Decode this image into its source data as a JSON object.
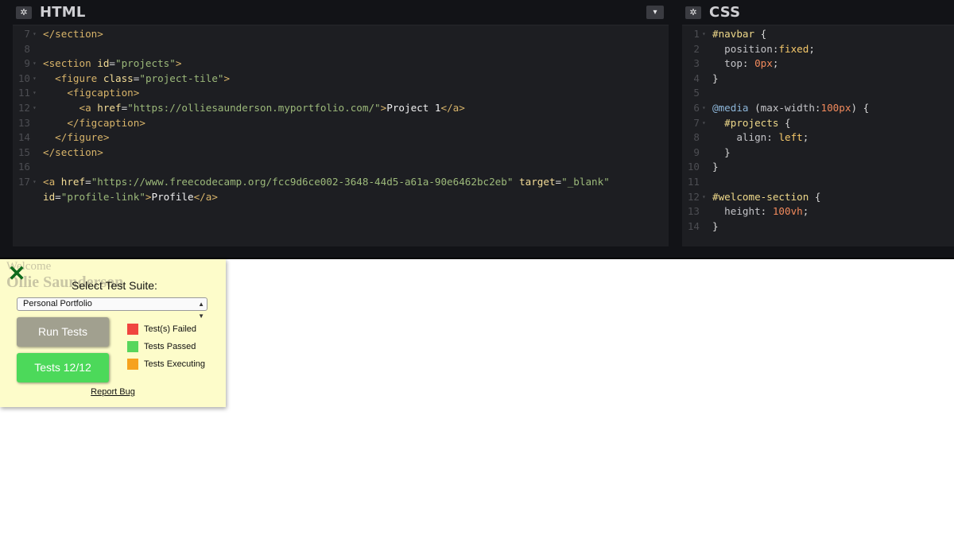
{
  "editors": {
    "html": {
      "title": "HTML",
      "lines": [
        {
          "n": "7",
          "fold": "▾",
          "parts": [
            {
              "c": "t-tag",
              "t": "</section>"
            }
          ]
        },
        {
          "n": "8",
          "fold": "",
          "parts": []
        },
        {
          "n": "9",
          "fold": "▾",
          "parts": [
            {
              "c": "t-tag",
              "t": "<section "
            },
            {
              "c": "t-attr",
              "t": "id"
            },
            {
              "c": "t-pun",
              "t": "="
            },
            {
              "c": "t-str",
              "t": "\"projects\""
            },
            {
              "c": "t-tag",
              "t": ">"
            }
          ]
        },
        {
          "n": "10",
          "fold": "▾",
          "parts": [
            {
              "c": "t-pun",
              "t": "  "
            },
            {
              "c": "t-tag",
              "t": "<figure "
            },
            {
              "c": "t-attr",
              "t": "class"
            },
            {
              "c": "t-pun",
              "t": "="
            },
            {
              "c": "t-str",
              "t": "\"project-tile\""
            },
            {
              "c": "t-tag",
              "t": ">"
            }
          ]
        },
        {
          "n": "11",
          "fold": "▾",
          "parts": [
            {
              "c": "t-pun",
              "t": "    "
            },
            {
              "c": "t-tag",
              "t": "<figcaption>"
            }
          ]
        },
        {
          "n": "12",
          "fold": "▾",
          "parts": [
            {
              "c": "t-pun",
              "t": "      "
            },
            {
              "c": "t-tag",
              "t": "<a "
            },
            {
              "c": "t-attr",
              "t": "href"
            },
            {
              "c": "t-pun",
              "t": "="
            },
            {
              "c": "t-str",
              "t": "\"https://olliesaunderson.myportfolio.com/\""
            },
            {
              "c": "t-tag",
              "t": ">"
            },
            {
              "c": "t-txt",
              "t": "Project 1"
            },
            {
              "c": "t-tag",
              "t": "</a>"
            }
          ]
        },
        {
          "n": "13",
          "fold": "",
          "parts": [
            {
              "c": "t-pun",
              "t": "    "
            },
            {
              "c": "t-tag",
              "t": "</figcaption>"
            }
          ]
        },
        {
          "n": "14",
          "fold": "",
          "parts": [
            {
              "c": "t-pun",
              "t": "  "
            },
            {
              "c": "t-tag",
              "t": "</figure>"
            }
          ]
        },
        {
          "n": "15",
          "fold": "",
          "parts": [
            {
              "c": "t-tag",
              "t": "</section>"
            }
          ]
        },
        {
          "n": "16",
          "fold": "",
          "parts": []
        },
        {
          "n": "17",
          "fold": "▾",
          "parts": [
            {
              "c": "t-tag",
              "t": "<a "
            },
            {
              "c": "t-attr",
              "t": "href"
            },
            {
              "c": "t-pun",
              "t": "="
            },
            {
              "c": "t-str",
              "t": "\"https://www.freecodecamp.org/fcc9d6ce002-3648-44d5-a61a-90e6462bc2eb\""
            },
            {
              "c": "t-pun",
              "t": " "
            },
            {
              "c": "t-attr",
              "t": "target"
            },
            {
              "c": "t-pun",
              "t": "="
            },
            {
              "c": "t-str",
              "t": "\"_blank\""
            }
          ]
        },
        {
          "n": "",
          "fold": "",
          "parts": [
            {
              "c": "t-attr",
              "t": "id"
            },
            {
              "c": "t-pun",
              "t": "="
            },
            {
              "c": "t-str",
              "t": "\"profile-link\""
            },
            {
              "c": "t-tag",
              "t": ">"
            },
            {
              "c": "t-txt",
              "t": "Profile"
            },
            {
              "c": "t-tag",
              "t": "</a>"
            }
          ]
        }
      ]
    },
    "css": {
      "title": "CSS",
      "lines": [
        {
          "n": "1",
          "fold": "▾",
          "parts": [
            {
              "c": "t-sel",
              "t": "#navbar "
            },
            {
              "c": "t-pun",
              "t": "{"
            }
          ]
        },
        {
          "n": "2",
          "fold": "",
          "parts": [
            {
              "c": "t-pun",
              "t": "  "
            },
            {
              "c": "t-prop",
              "t": "position"
            },
            {
              "c": "t-pun",
              "t": ":"
            },
            {
              "c": "t-kw",
              "t": "fixed"
            },
            {
              "c": "t-pun",
              "t": ";"
            }
          ]
        },
        {
          "n": "3",
          "fold": "",
          "parts": [
            {
              "c": "t-pun",
              "t": "  "
            },
            {
              "c": "t-prop",
              "t": "top"
            },
            {
              "c": "t-pun",
              "t": ": "
            },
            {
              "c": "t-num",
              "t": "0px"
            },
            {
              "c": "t-pun",
              "t": ";"
            }
          ]
        },
        {
          "n": "4",
          "fold": "",
          "parts": [
            {
              "c": "t-pun",
              "t": "}"
            }
          ]
        },
        {
          "n": "5",
          "fold": "",
          "parts": []
        },
        {
          "n": "6",
          "fold": "▾",
          "parts": [
            {
              "c": "t-at",
              "t": "@media "
            },
            {
              "c": "t-pun",
              "t": "("
            },
            {
              "c": "t-prop",
              "t": "max-width"
            },
            {
              "c": "t-pun",
              "t": ":"
            },
            {
              "c": "t-num",
              "t": "100px"
            },
            {
              "c": "t-pun",
              "t": ") {"
            }
          ]
        },
        {
          "n": "7",
          "fold": "▾",
          "parts": [
            {
              "c": "t-pun",
              "t": "  "
            },
            {
              "c": "t-sel",
              "t": "#projects "
            },
            {
              "c": "t-pun",
              "t": "{"
            }
          ]
        },
        {
          "n": "8",
          "fold": "",
          "parts": [
            {
              "c": "t-pun",
              "t": "    "
            },
            {
              "c": "t-prop",
              "t": "align"
            },
            {
              "c": "t-pun",
              "t": ": "
            },
            {
              "c": "t-kw",
              "t": "left"
            },
            {
              "c": "t-pun",
              "t": ";"
            }
          ]
        },
        {
          "n": "9",
          "fold": "",
          "parts": [
            {
              "c": "t-pun",
              "t": "  }"
            }
          ]
        },
        {
          "n": "10",
          "fold": "",
          "parts": [
            {
              "c": "t-pun",
              "t": "}"
            }
          ]
        },
        {
          "n": "11",
          "fold": "",
          "parts": []
        },
        {
          "n": "12",
          "fold": "▾",
          "parts": [
            {
              "c": "t-sel",
              "t": "#welcome-section "
            },
            {
              "c": "t-pun",
              "t": "{"
            }
          ]
        },
        {
          "n": "13",
          "fold": "",
          "parts": [
            {
              "c": "t-pun",
              "t": "  "
            },
            {
              "c": "t-prop",
              "t": "height"
            },
            {
              "c": "t-pun",
              "t": ": "
            },
            {
              "c": "t-num",
              "t": "100vh"
            },
            {
              "c": "t-pun",
              "t": ";"
            }
          ]
        },
        {
          "n": "14",
          "fold": "",
          "parts": [
            {
              "c": "t-pun",
              "t": "}"
            }
          ]
        }
      ]
    }
  },
  "preview": {
    "welcome": "Welcome",
    "name": "Ollie Saunderson"
  },
  "tests": {
    "close_icon": "✕",
    "suite_title": "Select Test Suite:",
    "selected_suite": "Personal Portfolio",
    "run_label": "Run Tests",
    "tests_label": "Tests 12/12",
    "legend": [
      {
        "label": "Test(s) Failed",
        "color": "#f0453f"
      },
      {
        "label": "Tests Passed",
        "color": "#58d65c"
      },
      {
        "label": "Tests Executing",
        "color": "#f6a21e"
      }
    ],
    "report_bug": "Report Bug"
  }
}
